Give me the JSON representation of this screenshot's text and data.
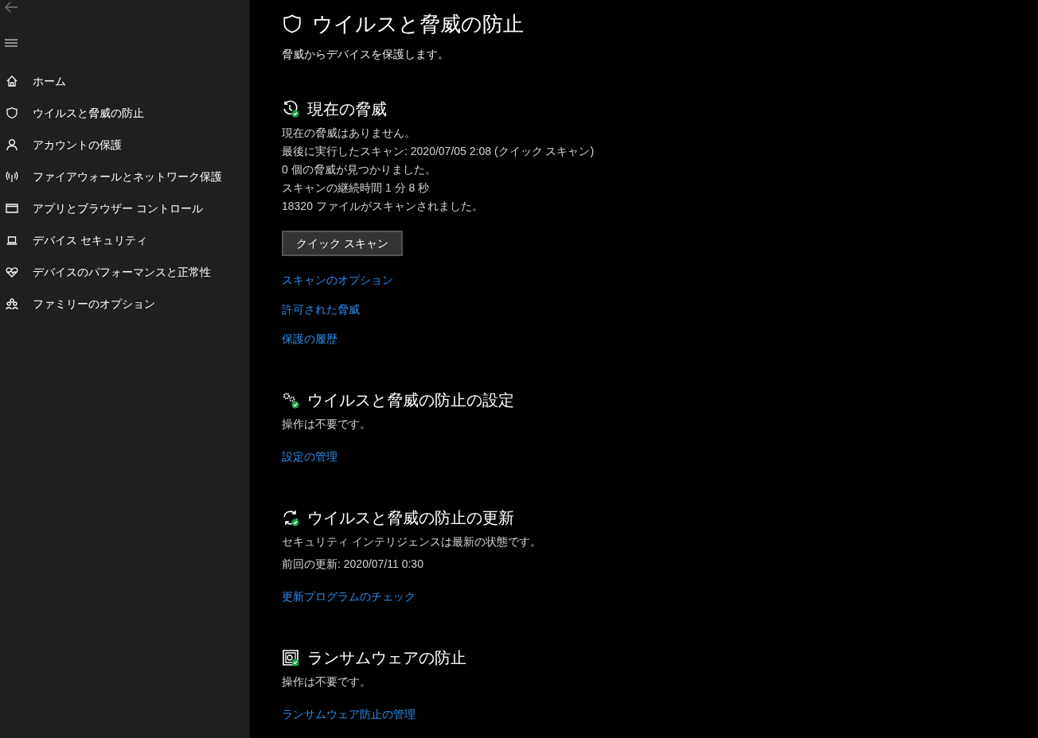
{
  "sidebar": {
    "items": [
      {
        "kind": "home",
        "label": "ホーム"
      },
      {
        "kind": "shield",
        "label": "ウイルスと脅威の防止"
      },
      {
        "kind": "person",
        "label": "アカウントの保護"
      },
      {
        "kind": "antenna",
        "label": "ファイアウォールとネットワーク保護"
      },
      {
        "kind": "window",
        "label": "アプリとブラウザー コントロール"
      },
      {
        "kind": "laptop",
        "label": "デバイス セキュリティ"
      },
      {
        "kind": "heart",
        "label": "デバイスのパフォーマンスと正常性"
      },
      {
        "kind": "family",
        "label": "ファミリーのオプション"
      }
    ]
  },
  "page": {
    "title": "ウイルスと脅威の防止",
    "subtitle": "脅威からデバイスを保護します。"
  },
  "sections": [
    {
      "kind": "history",
      "title": "現在の脅威",
      "lines": [
        "現在の脅威はありません。",
        "最後に実行したスキャン: 2020/07/05 2:08 (クイック スキャン)",
        "0 個の脅威が見つかりました。",
        "スキャンの継続時間 1 分 8 秒",
        "18320 ファイルがスキャンされました。"
      ],
      "button": "クイック スキャン",
      "links": [
        "スキャンのオプション",
        "許可された脅威",
        "保護の履歴"
      ]
    },
    {
      "kind": "gears",
      "title": "ウイルスと脅威の防止の設定",
      "lines": [
        "操作は不要です。"
      ],
      "links": [
        "設定の管理"
      ]
    },
    {
      "kind": "refresh",
      "title": "ウイルスと脅威の防止の更新",
      "lines": [
        "セキュリティ インテリジェンスは最新の状態です。",
        "前回の更新: 2020/07/11 0:30"
      ],
      "links": [
        "更新プログラムのチェック"
      ]
    },
    {
      "kind": "vault",
      "title": "ランサムウェアの防止",
      "lines": [
        "操作は不要です。"
      ],
      "links": [
        "ランサムウェア防止の管理"
      ]
    }
  ]
}
